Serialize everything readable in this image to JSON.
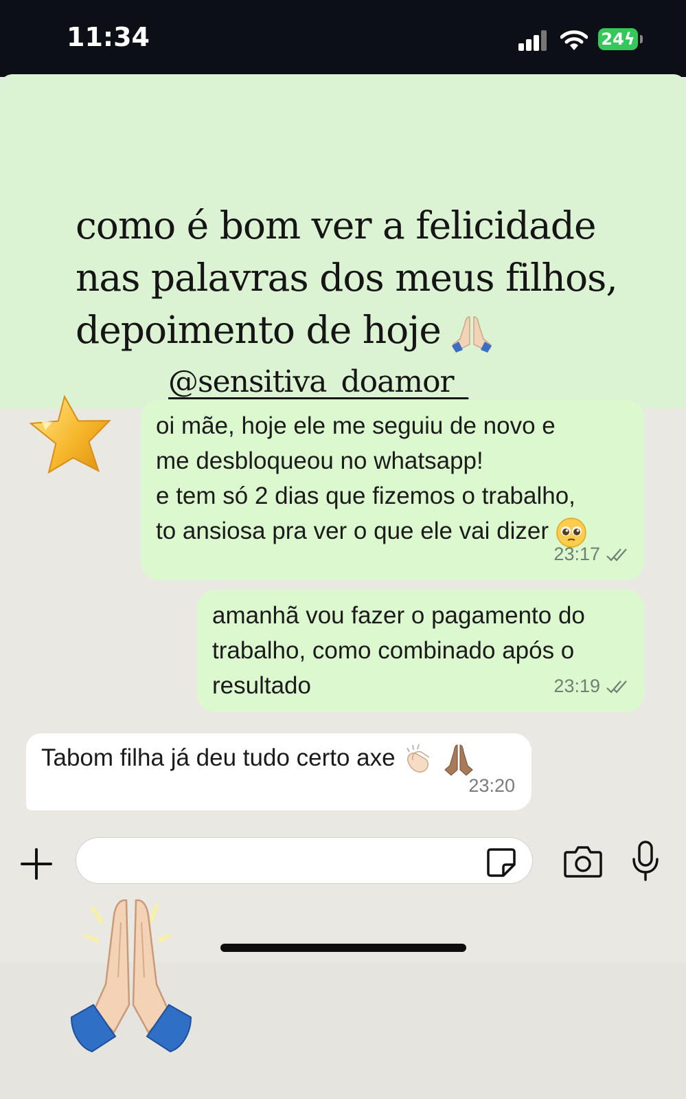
{
  "status_bar": {
    "time": "11:34",
    "battery": "24",
    "icons": [
      "signal-icon",
      "wifi-icon",
      "battery-charging-icon"
    ]
  },
  "story": {
    "caption_lines": [
      "como é bom ver a felicidade",
      "nas palavras dos meus filhos,",
      "depoimento de hoje"
    ],
    "handle": "@sensitiva_doamor_",
    "background": "#dcf3d3"
  },
  "messages": [
    {
      "direction": "outgoing",
      "lines": [
        "oi mãe, hoje ele me seguiu de novo e",
        "me desbloqueou no whatsapp!",
        "e tem só 2 dias que fizemos o trabalho,",
        "to ansiosa pra ver o que ele vai dizer"
      ],
      "time": "23:17",
      "emoji": "pleading-face",
      "status": "read"
    },
    {
      "direction": "outgoing",
      "lines": [
        "amanhã vou fazer o pagamento do",
        "trabalho, como combinado após o",
        "resultado"
      ],
      "time": "23:19",
      "status": "read"
    },
    {
      "direction": "incoming",
      "text": "Tabom filha já deu tudo certo axe",
      "time": "23:20",
      "emoji": [
        "clapping-hands",
        "praying-hands"
      ]
    }
  ],
  "composer": {
    "placeholder": "",
    "icons": [
      "plus-icon",
      "sticker-icon",
      "camera-icon",
      "microphone-icon"
    ]
  },
  "colors": {
    "outgoing_bubble": "#dbf8cf",
    "incoming_bubble": "#ffffff",
    "chat_background": "#e9e8e3",
    "status_bar": "#0c0f16",
    "battery": "#35c759"
  }
}
